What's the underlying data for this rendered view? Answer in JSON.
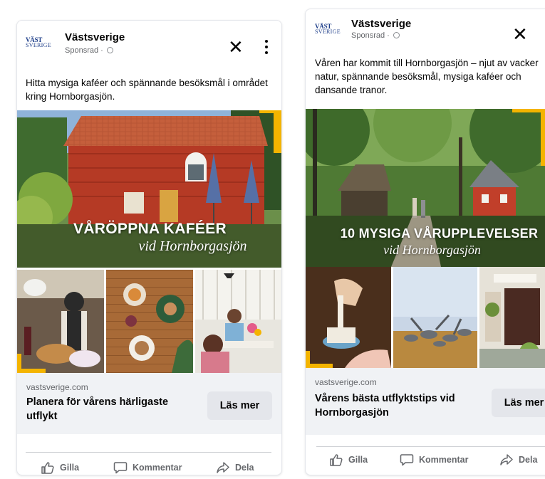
{
  "ad_left": {
    "advertiser": "Västsverige",
    "sponsored": "Sponsrad · ",
    "logo_line1": "VÄST",
    "logo_line2": "SVERIGE",
    "close_glyph": "✕",
    "primary_text": "Hitta mysiga kaféer och spännande besöksmål i området kring Hornborgasjön.",
    "hero_title": "VÅRÖPPNA KAFÉER",
    "hero_subtitle": "vid Hornborgasjön",
    "link_domain": "vastsverige.com",
    "link_headline": "Planera för vårens härligaste utflykt",
    "cta": "Läs mer",
    "actions": {
      "like": "Gilla",
      "comment": "Kommentar",
      "share": "Dela"
    },
    "accent_color": "#f4b400"
  },
  "ad_right": {
    "advertiser": "Västsverige",
    "sponsored": "Sponsrad · ",
    "logo_line1": "VÄST",
    "logo_line2": "SVERIGE",
    "close_glyph": "✕",
    "primary_text": "Våren har kommit till Hornborgasjön – njut av vacker natur, spännande besöksmål, mysiga kaféer och dansande tranor.",
    "hero_title": "10 MYSIGA VÅRUPPLEVELSER",
    "hero_subtitle": "vid Hornborgasjön",
    "link_domain": "vastsverige.com",
    "link_headline": "Vårens bästa utflyktstips vid Hornborgasjön",
    "cta": "Läs mer",
    "actions": {
      "like": "Gilla",
      "comment": "Kommentar",
      "share": "Dela"
    },
    "accent_color": "#f4b400"
  }
}
